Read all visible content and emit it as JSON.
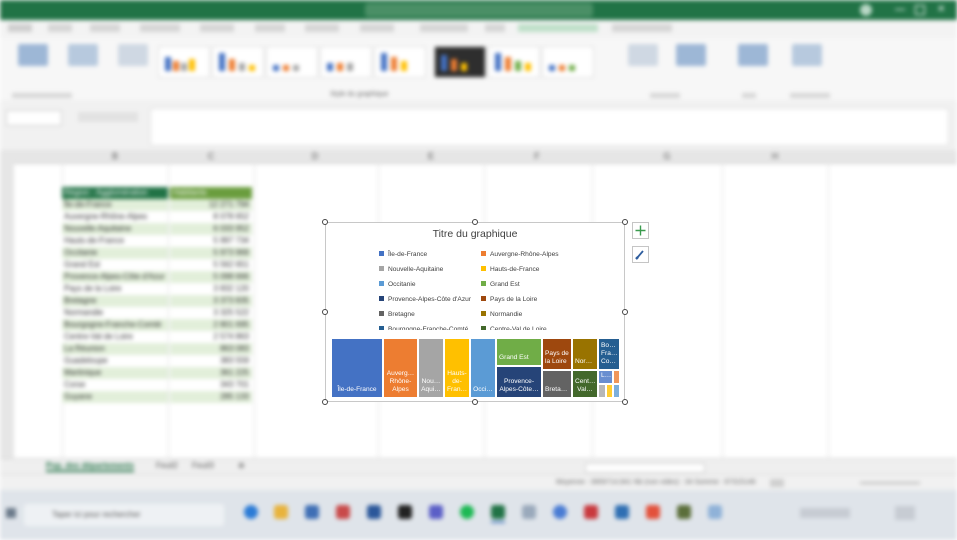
{
  "excel": {
    "ribbon_group_label": "Style du graphique",
    "columns": [
      "B",
      "C",
      "D",
      "E",
      "F",
      "G",
      "H"
    ],
    "table": {
      "header_a": "Région - Agglomération",
      "header_b": "Habitants",
      "rows": [
        {
          "label": "Île-de-France",
          "value": "12 271 794"
        },
        {
          "label": "Auvergne-Rhône-Alpes",
          "value": "8 078 652"
        },
        {
          "label": "Nouvelle-Aquitaine",
          "value": "6 033 952"
        },
        {
          "label": "Hauts-de-France",
          "value": "5 997 734"
        },
        {
          "label": "Occitanie",
          "value": "5 973 969"
        },
        {
          "label": "Grand Est",
          "value": "5 562 651"
        },
        {
          "label": "Provence-Alpes-Côte d'Azur",
          "value": "5 098 666"
        },
        {
          "label": "Pays de la Loire",
          "value": "3 832 120"
        },
        {
          "label": "Bretagne",
          "value": "3 373 835"
        },
        {
          "label": "Normandie",
          "value": "3 325 522"
        },
        {
          "label": "Bourgogne-Franche-Comté",
          "value": "2 801 695"
        },
        {
          "label": "Centre-Val de Loire",
          "value": "2 574 863"
        },
        {
          "label": "La Réunion",
          "value": "863 083"
        },
        {
          "label": "Guadeloupe",
          "value": "383 559"
        },
        {
          "label": "Martinique",
          "value": "361 225"
        },
        {
          "label": "Corse",
          "value": "343 701"
        },
        {
          "label": "Guyane",
          "value": "285 133"
        }
      ]
    },
    "sheet_tabs": [
      "Pop. des départements",
      "Feuil2",
      "Feuil3"
    ],
    "status_text": "Moyenne : 3959714,941   Nb (non vides) : 34   Somme : 67315146",
    "taskbar_search_placeholder": "Taper ici pour rechercher"
  },
  "chart": {
    "title": "Titre du graphique",
    "legend": [
      {
        "name": "Île-de-France",
        "color": "#4472c4"
      },
      {
        "name": "Auvergne-Rhône-Alpes",
        "color": "#ed7d31"
      },
      {
        "name": "Nouvelle-Aquitaine",
        "color": "#a5a5a5"
      },
      {
        "name": "Hauts-de-France",
        "color": "#ffc000"
      },
      {
        "name": "Occitanie",
        "color": "#5b9bd5"
      },
      {
        "name": "Grand Est",
        "color": "#70ad47"
      },
      {
        "name": "Provence-Alpes-Côte d'Azur",
        "color": "#264478"
      },
      {
        "name": "Pays de la Loire",
        "color": "#9e480e"
      },
      {
        "name": "Bretagne",
        "color": "#636363"
      },
      {
        "name": "Normandie",
        "color": "#997300"
      },
      {
        "name": "Bourgogne-Franche-Comté",
        "color": "#255e91"
      },
      {
        "name": "Centre-Val de Loire",
        "color": "#43682b"
      }
    ],
    "tiles": [
      {
        "label": "Île-de-France",
        "color": "#4472c4"
      },
      {
        "label": "Auverg… Rhône-Alpes",
        "color": "#ed7d31"
      },
      {
        "label": "Nou… Aqui…",
        "color": "#a5a5a5"
      },
      {
        "label": "Hauts-de-Fran…",
        "color": "#ffc000"
      },
      {
        "label": "Occi…",
        "color": "#5b9bd5"
      },
      {
        "label": "Grand Est",
        "color": "#70ad47"
      },
      {
        "label": "Provence-Alpes-Côte…",
        "color": "#264478"
      },
      {
        "label": "Pays de la Loire",
        "color": "#9e480e"
      },
      {
        "label": "Breta…",
        "color": "#636363"
      },
      {
        "label": "Nor…",
        "color": "#997300"
      },
      {
        "label": "Cent… Val…",
        "color": "#43682b"
      },
      {
        "label": "Bo… Fra… Co…",
        "color": "#255e91"
      },
      {
        "label": "L…",
        "color": "#698ed0"
      },
      {
        "label": "",
        "color": "#f1975a"
      },
      {
        "label": "",
        "color": "#b7b7b7"
      },
      {
        "label": "",
        "color": "#ffcd33"
      },
      {
        "label": "",
        "color": "#7cafdd"
      }
    ]
  }
}
